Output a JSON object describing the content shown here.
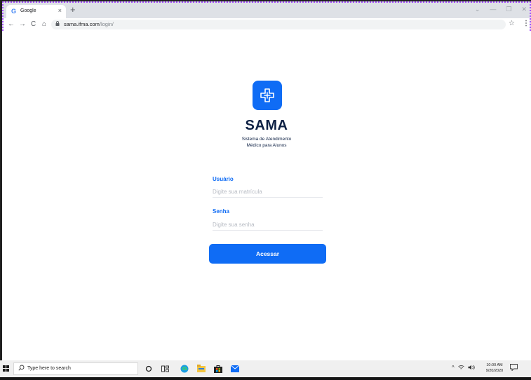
{
  "browser": {
    "tab_title": "Google",
    "tab_favicon": "G",
    "tab_close": "×",
    "new_tab": "+",
    "window_controls": [
      "⌄",
      "—",
      "❐",
      "✕"
    ],
    "back": "←",
    "forward": "→",
    "reload": "C",
    "home": "⌂",
    "url_host": "sama.ifma.com",
    "url_path": "/login/",
    "bookmark_icon": "☆",
    "menu_icon": "⋮"
  },
  "app": {
    "name": "SAMA",
    "subtitle_line1": "Sistema de Atendimento",
    "subtitle_line2": "Médico para Alunos",
    "logo_icon": "medical-cross-icon",
    "accent_color": "#0f6cf5",
    "text_color": "#0e2144"
  },
  "form": {
    "user_label": "Usuário",
    "user_placeholder": "Digite sua matrícula",
    "user_value": "",
    "pass_label": "Senha",
    "pass_placeholder": "Digite sua senha",
    "pass_value": "",
    "submit_label": "Acessar"
  },
  "taskbar": {
    "search_placeholder": "Type here to search",
    "time": "10:00 AM",
    "date": "9/20/2020",
    "icons": [
      "cortana-icon",
      "task-view-icon",
      "edge-icon",
      "file-explorer-icon",
      "store-icon",
      "mail-icon"
    ]
  }
}
